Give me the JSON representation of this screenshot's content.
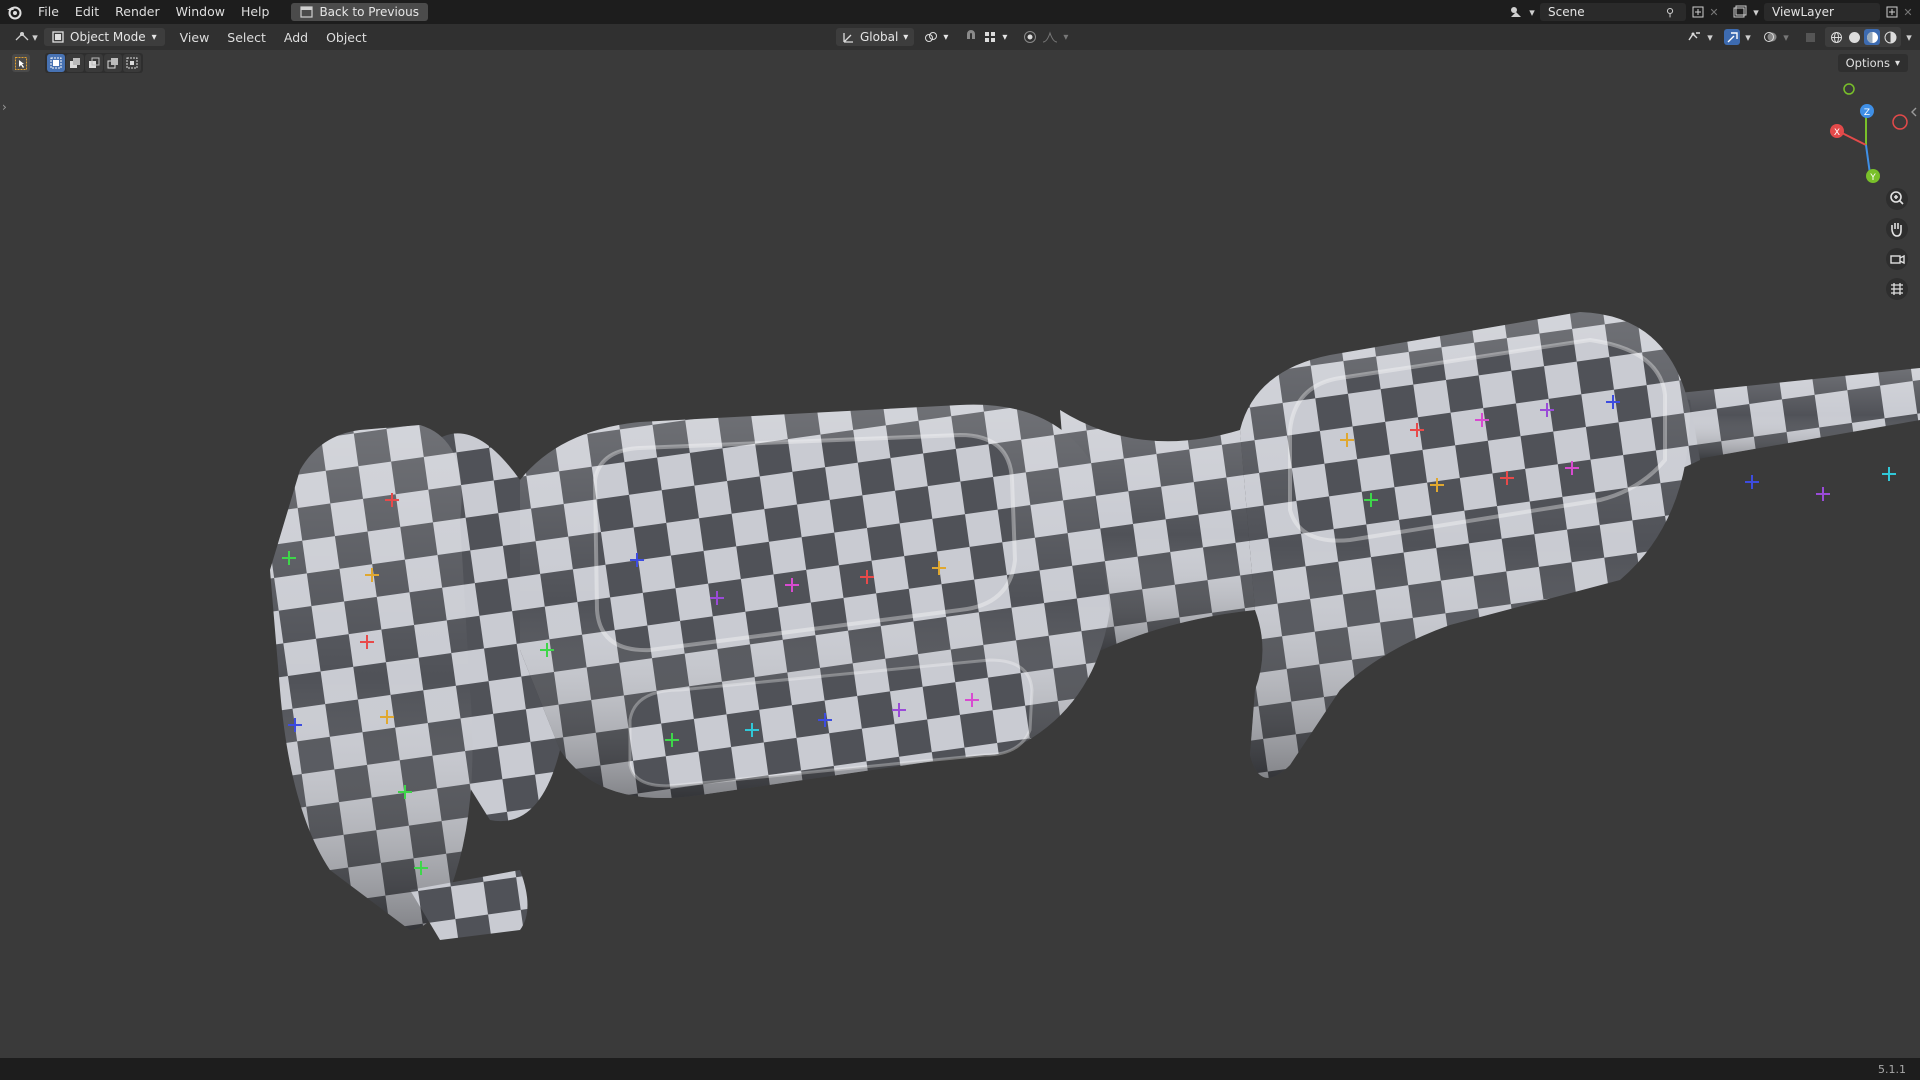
{
  "app": {
    "menu": [
      "File",
      "Edit",
      "Render",
      "Window",
      "Help"
    ],
    "back_button": "Back to Previous"
  },
  "topbar_right": {
    "scene_name": "Scene",
    "view_layer_name": "ViewLayer"
  },
  "header": {
    "mode": "Object Mode",
    "menus": [
      "View",
      "Select",
      "Add",
      "Object"
    ],
    "transform_orientation": "Global"
  },
  "toolbar": {
    "options_label": "Options"
  },
  "gizmo": {
    "axis_x": "X",
    "axis_y": "Y",
    "axis_z": "Z",
    "colors": {
      "x": "#e34a4a",
      "y": "#79c02a",
      "z": "#3f8fe6"
    }
  },
  "status": {
    "version": "5.1.1"
  },
  "icons": {
    "logo": "blender-logo-icon",
    "back": "back-to-previous-icon",
    "scene": "scene-icon",
    "view_layer": "view-layer-icon",
    "editor_type": "editor-type-icon",
    "object_mode": "object-mode-icon",
    "transform": "transform-orientation-icon",
    "snap": "snap-icon",
    "proportional": "proportional-edit-icon",
    "zoom": "zoom-icon",
    "pan": "pan-hand-icon",
    "camera": "camera-view-icon",
    "ortho": "ortho-grid-icon"
  }
}
